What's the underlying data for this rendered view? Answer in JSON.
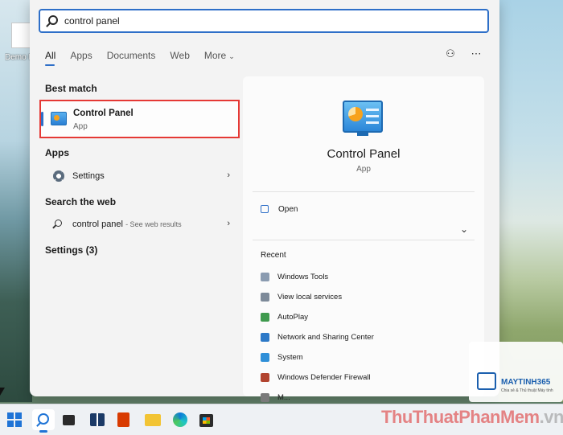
{
  "desktop": {
    "icon_label": "Demo\nPowerS"
  },
  "search": {
    "query": "control panel"
  },
  "tabs": [
    {
      "label": "All",
      "active": true
    },
    {
      "label": "Apps"
    },
    {
      "label": "Documents"
    },
    {
      "label": "Web"
    },
    {
      "label": "More"
    }
  ],
  "left": {
    "best_match_title": "Best match",
    "best_match": {
      "name": "Control Panel",
      "type": "App"
    },
    "apps_title": "Apps",
    "apps_item": "Settings",
    "web_title": "Search the web",
    "web_item": "control panel",
    "web_hint": "- See web results",
    "settings_section": "Settings (3)"
  },
  "detail": {
    "title": "Control Panel",
    "subtitle": "App",
    "open_label": "Open",
    "recent_title": "Recent",
    "recent": [
      {
        "label": "Windows Tools",
        "color": "#8a9bb0"
      },
      {
        "label": "View local services",
        "color": "#7d8a99"
      },
      {
        "label": "AutoPlay",
        "color": "#3f9a4e"
      },
      {
        "label": "Network and Sharing Center",
        "color": "#2c79c7"
      },
      {
        "label": "System",
        "color": "#2f8fd8"
      },
      {
        "label": "Windows Defender Firewall",
        "color": "#b2442f"
      },
      {
        "label": "M...",
        "color": "#7a7a7a"
      }
    ]
  },
  "watermark": {
    "logo_name": "MAYTINH365",
    "logo_tagline": "Chia sẻ & Thủ thuật Máy tính",
    "site_bold": "ThuThuat",
    "site_light": "PhanMem",
    "site_tail": ".vn"
  },
  "colors": {
    "accent": "#2e6fc8",
    "highlight_border": "#e53935"
  }
}
